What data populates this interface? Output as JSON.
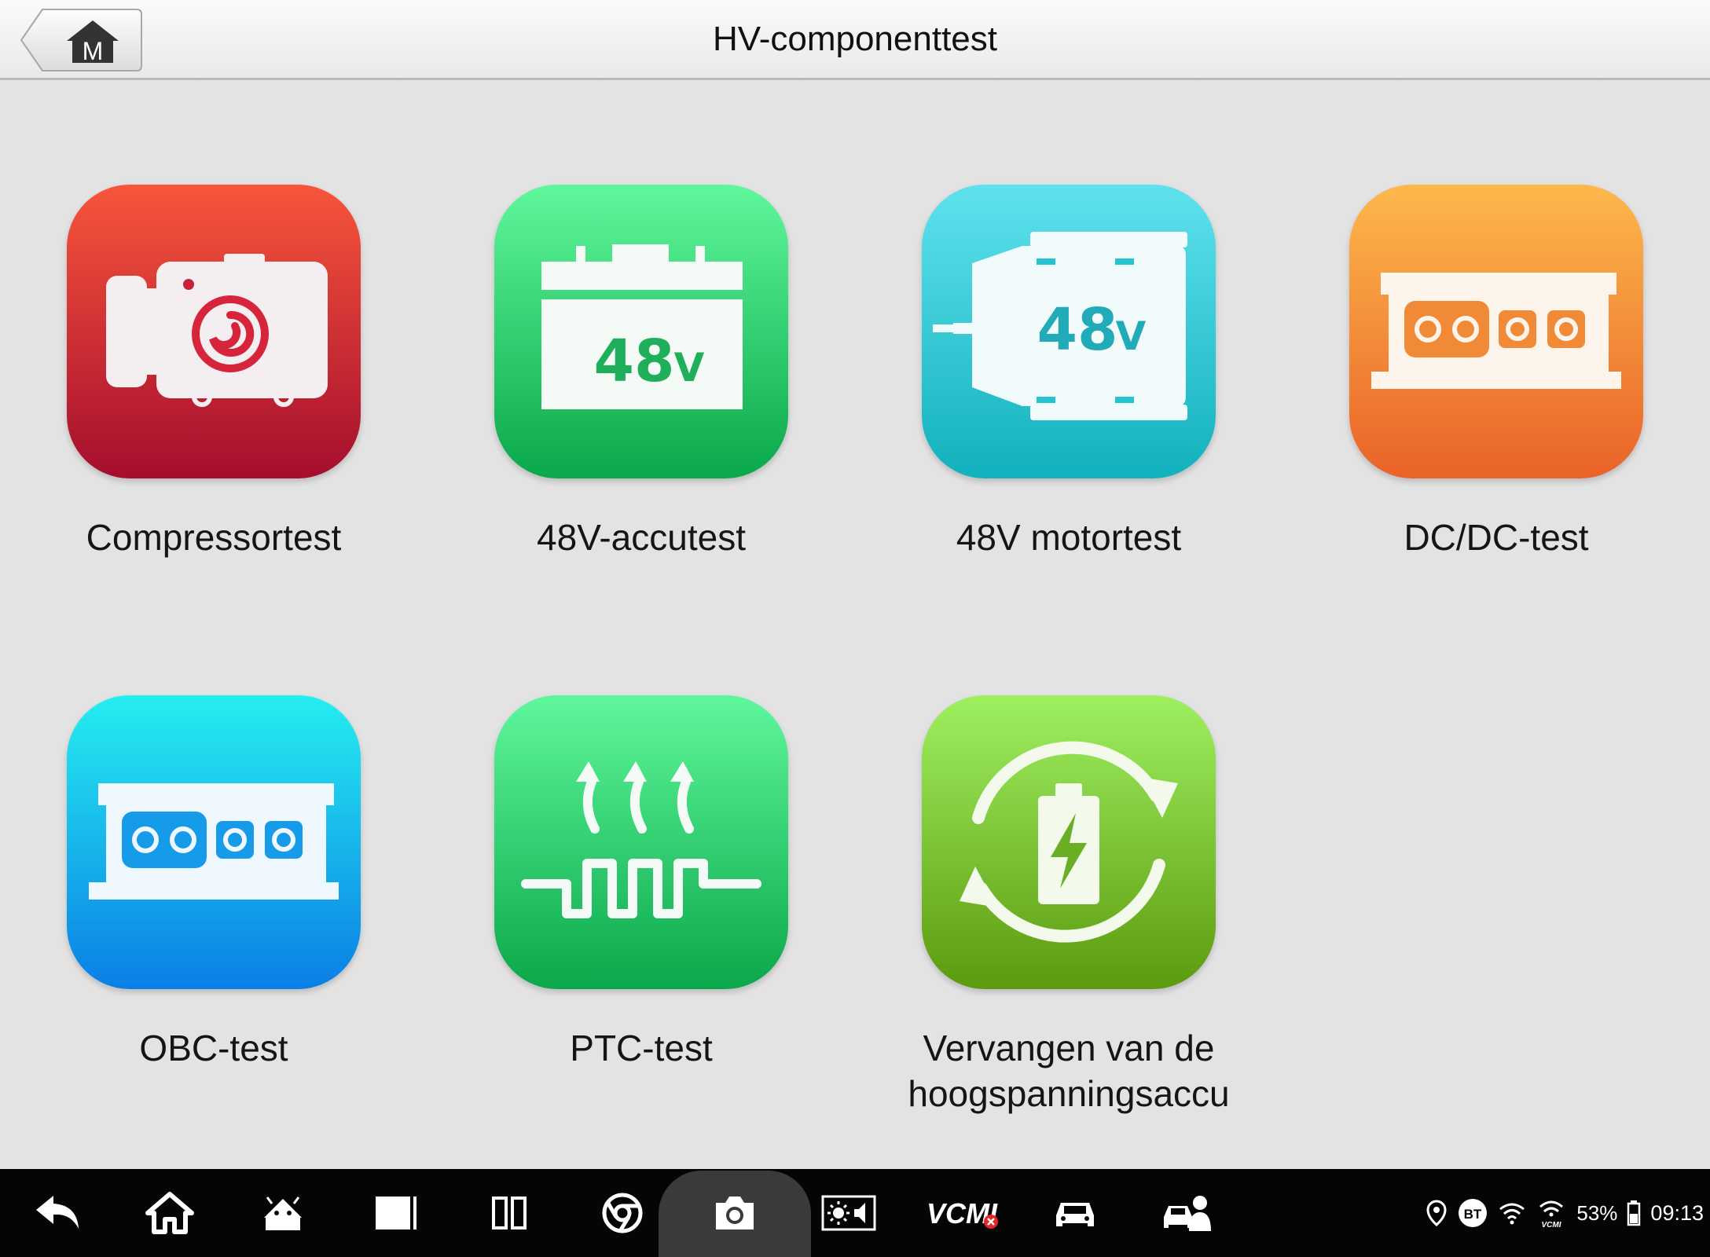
{
  "header": {
    "title": "HV-componenttest",
    "home_button_letter": "M"
  },
  "tiles": [
    {
      "label": "Compressortest",
      "icon": "compressor-icon",
      "color": "#d8323a"
    },
    {
      "label": "48V-accutest",
      "icon": "battery-48v-icon",
      "color": "#1ec36a",
      "icon_text": "48",
      "icon_unit": "V"
    },
    {
      "label": "48V motortest",
      "icon": "motor-48v-icon",
      "color": "#25c2d0",
      "icon_text": "48",
      "icon_unit": "V"
    },
    {
      "label": "DC/DC-test",
      "icon": "dcdc-converter-icon",
      "color": "#f48a2e"
    },
    {
      "label": "OBC-test",
      "icon": "onboard-charger-icon",
      "color": "#1aa6ee"
    },
    {
      "label": "PTC-test",
      "icon": "ptc-heater-icon",
      "color": "#1ec36a"
    },
    {
      "label": "Vervangen van de hoogspanningsaccu",
      "label_line1": "Vervangen van de",
      "label_line2": "hoogspanningsaccu",
      "icon": "battery-replace-icon",
      "color": "#78c23a"
    }
  ],
  "system_bar": {
    "buttons": [
      "back-icon",
      "home-icon",
      "android-icon",
      "recent-apps-icon",
      "split-screen-icon",
      "browser-icon",
      "camera-icon",
      "brightness-volume-icon",
      "vcmi-icon",
      "car-icon",
      "car-support-icon"
    ],
    "vcmi_label": "VCMI",
    "status": {
      "bt_label": "BT",
      "vcmi_small": "VCMI",
      "battery": "53%",
      "time": "09:13"
    }
  }
}
